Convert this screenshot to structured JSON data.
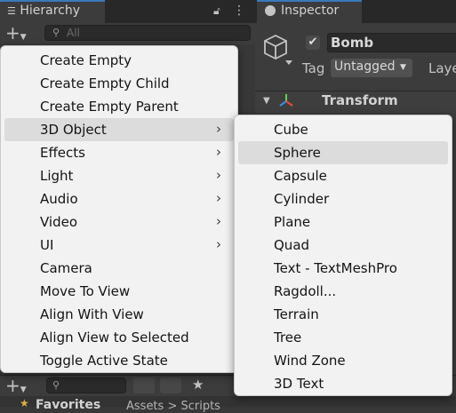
{
  "hierarchy": {
    "title": "Hierarchy",
    "search_placeholder": "All",
    "add_button": "+"
  },
  "inspector": {
    "title": "Inspector",
    "object_name": "Bomb",
    "tag_label": "Tag",
    "tag_value": "Untagged",
    "layer_label": "Laye",
    "transform_label": "Transform"
  },
  "create_menu": {
    "items": [
      {
        "label": "Create Empty",
        "submenu": false
      },
      {
        "label": "Create Empty Child",
        "submenu": false
      },
      {
        "label": "Create Empty Parent",
        "submenu": false
      },
      {
        "label": "3D Object",
        "submenu": true
      },
      {
        "label": "Effects",
        "submenu": true
      },
      {
        "label": "Light",
        "submenu": true
      },
      {
        "label": "Audio",
        "submenu": true
      },
      {
        "label": "Video",
        "submenu": true
      },
      {
        "label": "UI",
        "submenu": true
      },
      {
        "label": "Camera",
        "submenu": false
      },
      {
        "label": "Move To View",
        "submenu": false
      },
      {
        "label": "Align With View",
        "submenu": false
      },
      {
        "label": "Align View to Selected",
        "submenu": false
      },
      {
        "label": "Toggle Active State",
        "submenu": false
      }
    ],
    "highlighted": "3D Object"
  },
  "object_submenu": {
    "items": [
      "Cube",
      "Sphere",
      "Capsule",
      "Cylinder",
      "Plane",
      "Quad",
      "Text - TextMeshPro",
      "Ragdoll...",
      "Terrain",
      "Tree",
      "Wind Zone",
      "3D Text"
    ],
    "highlighted": "Sphere"
  },
  "project": {
    "favorites_label": "Favorites",
    "assets_label": "Assets > Scripts"
  },
  "colors": {
    "menu_bg": "#f2f2f2",
    "highlight": "#dcdcdc",
    "tab_accent": "#3a79bb",
    "panel_bg": "#3c3c3c"
  },
  "icons": [
    "hierarchy-icon",
    "lock-icon",
    "more-icon",
    "search-icon",
    "inspector-icon",
    "cube-icon",
    "check-icon",
    "transform-axes-icon",
    "chevron-right-icon",
    "star-icon"
  ]
}
